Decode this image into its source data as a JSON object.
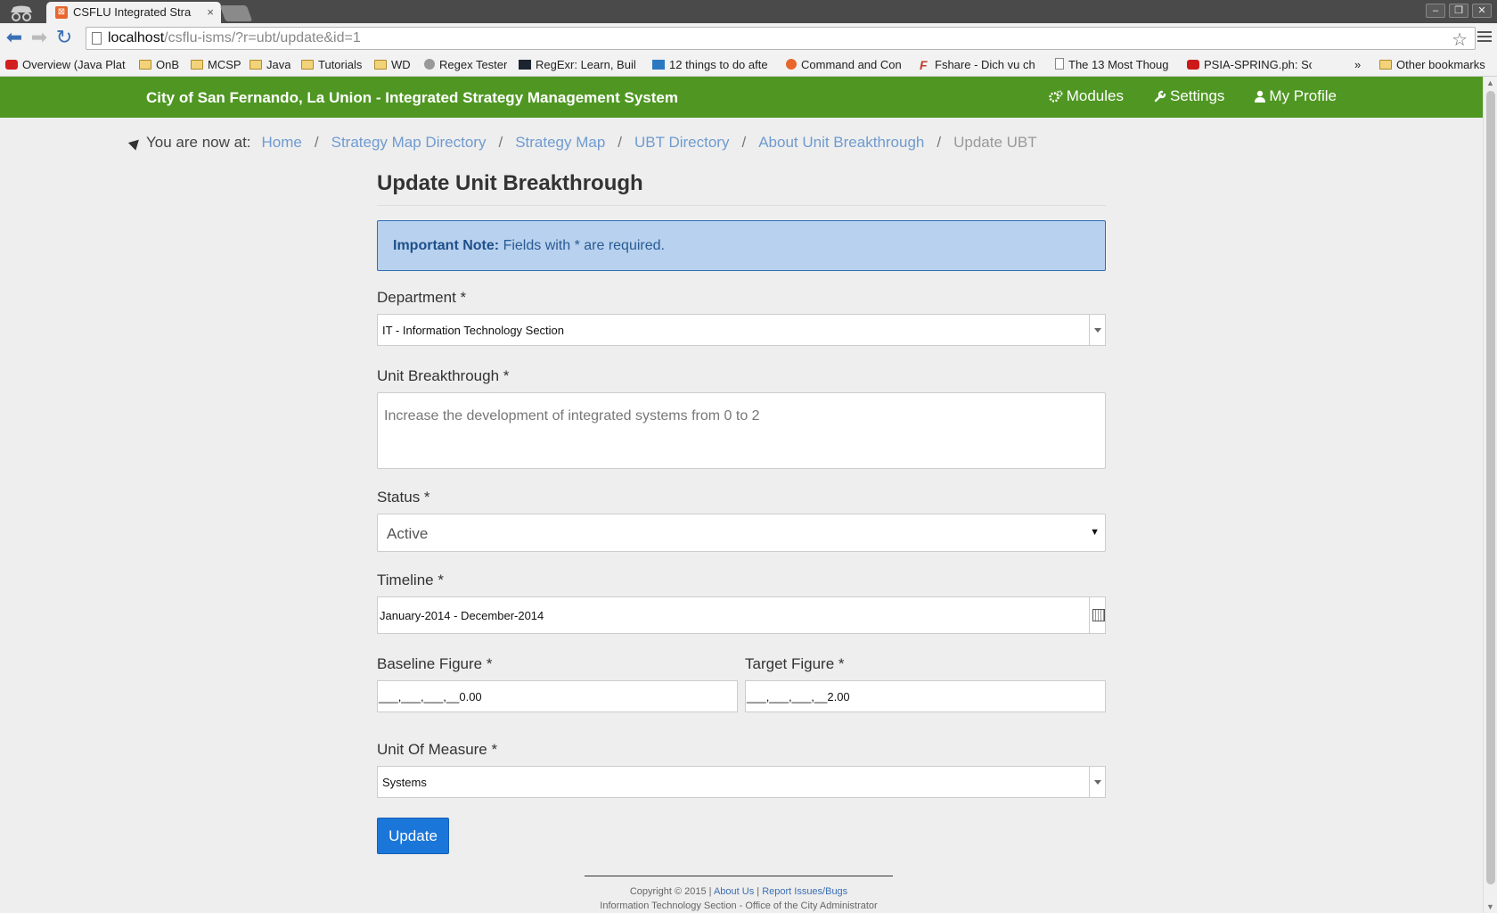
{
  "browser": {
    "tab_title": "CSFLU Integrated Stra",
    "tab_close": "×",
    "url_host": "localhost",
    "url_path": "/csflu-isms/?r=ubt/update&id=1",
    "bookmarks": [
      {
        "label": "Overview (Java Plat",
        "icon": "red"
      },
      {
        "label": "OnB",
        "icon": "folder"
      },
      {
        "label": "MCSP",
        "icon": "folder"
      },
      {
        "label": "Java",
        "icon": "folder"
      },
      {
        "label": "Tutorials",
        "icon": "folder"
      },
      {
        "label": "WD",
        "icon": "folder"
      },
      {
        "label": "Regex Tester",
        "icon": "gray"
      },
      {
        "label": "RegExr: Learn, Buil",
        "icon": "dark"
      },
      {
        "label": "12 things to do afte",
        "icon": "blue"
      },
      {
        "label": "Command and Con",
        "icon": "ff"
      },
      {
        "label": "Fshare - Dich vu ch",
        "icon": "fs"
      },
      {
        "label": "The 13 Most Thoug",
        "icon": "doc"
      },
      {
        "label": "PSIA-SPRING.ph: Sc",
        "icon": "yt"
      }
    ],
    "more_bookmarks": "»",
    "other_bookmarks": "Other bookmarks"
  },
  "navbar": {
    "brand": "City of San Fernando, La Union - Integrated Strategy Management System",
    "modules": "Modules",
    "settings": "Settings",
    "profile": "My Profile"
  },
  "breadcrumb": {
    "prefix": "You are now at:",
    "items": [
      "Home",
      "Strategy Map Directory",
      "Strategy Map",
      "UBT Directory",
      "About Unit Breakthrough"
    ],
    "current": "Update UBT",
    "separator": "/"
  },
  "form": {
    "title": "Update Unit Breakthrough",
    "note_label": "Important Note:",
    "note_text": "Fields with * are required.",
    "department_label": "Department *",
    "department_value": "IT - Information Technology Section",
    "ubt_label": "Unit Breakthrough *",
    "ubt_value": "Increase the development of integrated systems from 0 to 2",
    "status_label": "Status *",
    "status_value": "Active",
    "timeline_label": "Timeline *",
    "timeline_value": "January-2014 - December-2014",
    "baseline_label": "Baseline Figure *",
    "baseline_value": "___,___,___,__0.00",
    "target_label": "Target Figure *",
    "target_value": "___,___,___,__2.00",
    "uom_label": "Unit Of Measure *",
    "uom_value": "Systems",
    "update_button": "Update"
  },
  "footer": {
    "copyright": "Copyright © 2015",
    "about": "About Us",
    "report": "Report Issues/Bugs",
    "office": "Information Technology Section - Office of the City Administrator",
    "divider": "|"
  }
}
